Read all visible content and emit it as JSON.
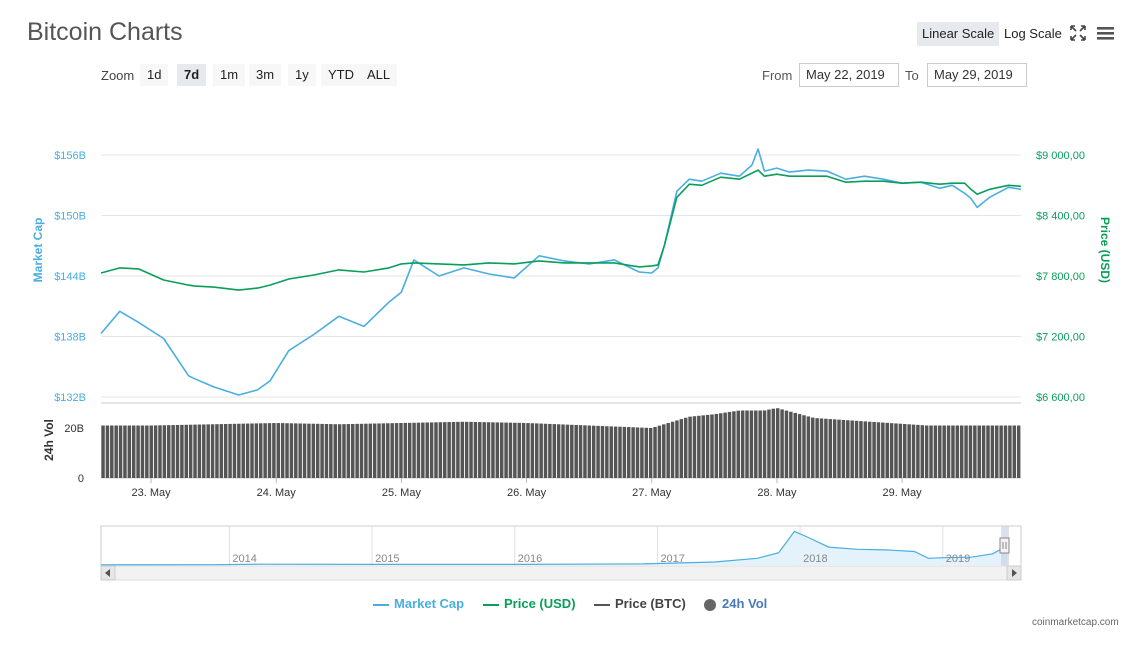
{
  "header": {
    "title": "Bitcoin Charts",
    "linear_scale_label": "Linear Scale",
    "log_scale_label": "Log Scale",
    "fullscreen_icon": "fullscreen-icon",
    "menu_icon": "hamburger-menu-icon"
  },
  "zoom": {
    "label": "Zoom",
    "buttons": [
      "1d",
      "7d",
      "1m",
      "3m",
      "1y",
      "YTD",
      "ALL"
    ],
    "active": "7d"
  },
  "range": {
    "from_label": "From",
    "from_value": "May 22, 2019",
    "to_label": "To",
    "to_value": "May 29, 2019"
  },
  "colors": {
    "market_cap": "#4aaee0",
    "price_usd": "#0a9e5a",
    "price_btc": "#555555",
    "volume": "#555555",
    "grid": "#e6e6e6"
  },
  "chart_data": {
    "type": "line",
    "left_axis": {
      "label": "Market Cap",
      "ticks": [
        "$156B",
        "$150B",
        "$144B",
        "$138B",
        "$132B"
      ],
      "tick_values": [
        156,
        150,
        144,
        138,
        132
      ],
      "range": [
        132,
        156
      ]
    },
    "right_axis": {
      "label": "Price (USD)",
      "ticks": [
        "$9 000,00",
        "$8 400,00",
        "$7 800,00",
        "$7 200,00",
        "$6 600,00"
      ],
      "tick_values": [
        9000,
        8400,
        7800,
        7200,
        6600
      ],
      "range": [
        6600,
        9000
      ]
    },
    "volume_axis": {
      "label": "24h Vol",
      "ticks": [
        "20B",
        "0"
      ],
      "tick_values": [
        20,
        0
      ],
      "range": [
        0,
        30
      ]
    },
    "x_labels": [
      "23. May",
      "24. May",
      "25. May",
      "26. May",
      "27. May",
      "28. May",
      "29. May"
    ],
    "x_label_days": [
      1,
      2,
      3,
      4,
      5,
      6,
      7
    ],
    "x_range_days": [
      0.6,
      7.95
    ],
    "series": [
      {
        "name": "Market Cap",
        "unit": "B",
        "x_days": [
          0.6,
          0.75,
          0.9,
          1.1,
          1.3,
          1.35,
          1.5,
          1.7,
          1.85,
          1.95,
          2.1,
          2.3,
          2.5,
          2.7,
          2.9,
          3.0,
          3.1,
          3.3,
          3.5,
          3.7,
          3.9,
          4.1,
          4.3,
          4.5,
          4.7,
          4.9,
          5.0,
          5.05,
          5.1,
          5.2,
          5.3,
          5.4,
          5.55,
          5.7,
          5.8,
          5.85,
          5.9,
          6.0,
          6.1,
          6.25,
          6.4,
          6.55,
          6.7,
          6.85,
          7.0,
          7.15,
          7.3,
          7.4,
          7.5,
          7.55,
          7.6,
          7.7,
          7.85,
          7.95
        ],
        "values": [
          138.3,
          140.5,
          139.4,
          137.8,
          134.1,
          133.8,
          133.0,
          132.2,
          132.7,
          133.6,
          136.6,
          138.2,
          140.0,
          139.0,
          141.4,
          142.4,
          145.6,
          144.0,
          144.8,
          144.2,
          143.8,
          146.0,
          145.5,
          145.2,
          145.6,
          144.4,
          144.3,
          144.8,
          147.0,
          152.4,
          153.6,
          153.4,
          154.2,
          153.9,
          155.0,
          156.6,
          154.4,
          154.7,
          154.3,
          154.5,
          154.4,
          153.6,
          153.9,
          153.6,
          153.2,
          153.3,
          152.7,
          153.0,
          152.2,
          151.7,
          150.8,
          151.8,
          152.8,
          152.6
        ]
      },
      {
        "name": "Price (USD)",
        "unit": "USD",
        "x_days": [
          0.6,
          0.75,
          0.9,
          1.1,
          1.3,
          1.35,
          1.5,
          1.7,
          1.85,
          1.95,
          2.1,
          2.3,
          2.5,
          2.7,
          2.9,
          3.0,
          3.1,
          3.3,
          3.5,
          3.7,
          3.9,
          4.1,
          4.3,
          4.5,
          4.7,
          4.9,
          5.0,
          5.05,
          5.1,
          5.2,
          5.3,
          5.4,
          5.55,
          5.7,
          5.8,
          5.85,
          5.9,
          6.0,
          6.1,
          6.25,
          6.4,
          6.55,
          6.7,
          6.85,
          7.0,
          7.15,
          7.3,
          7.4,
          7.5,
          7.55,
          7.6,
          7.7,
          7.85,
          7.95
        ],
        "values": [
          7830,
          7880,
          7870,
          7760,
          7710,
          7700,
          7690,
          7660,
          7680,
          7710,
          7770,
          7810,
          7860,
          7840,
          7880,
          7920,
          7930,
          7920,
          7910,
          7930,
          7920,
          7950,
          7930,
          7930,
          7930,
          7890,
          7900,
          7910,
          8100,
          8580,
          8710,
          8700,
          8780,
          8760,
          8820,
          8850,
          8790,
          8810,
          8790,
          8790,
          8790,
          8730,
          8740,
          8740,
          8720,
          8730,
          8710,
          8720,
          8720,
          8660,
          8610,
          8660,
          8700,
          8690
        ]
      },
      {
        "name": "Price (BTC)",
        "x_days": [],
        "values": []
      },
      {
        "name": "24h Vol",
        "unit": "B",
        "x_days": [
          0.6,
          1.0,
          1.5,
          2.0,
          2.5,
          3.0,
          3.5,
          4.0,
          4.5,
          5.0,
          5.1,
          5.3,
          5.5,
          5.7,
          5.9,
          6.0,
          6.3,
          6.6,
          6.9,
          7.2,
          7.5,
          7.95
        ],
        "values": [
          21,
          21,
          21.5,
          22,
          21.5,
          22,
          22.5,
          22,
          21,
          20,
          21.5,
          24.5,
          25.5,
          27,
          27,
          28,
          24,
          23,
          22,
          21,
          21,
          21
        ]
      }
    ],
    "navigator": {
      "labels": [
        "2014",
        "2015",
        "2016",
        "2017",
        "2018",
        "2019"
      ],
      "years": [
        2014,
        2015,
        2016,
        2017,
        2018,
        2019
      ],
      "range_years": [
        2013.1,
        2019.45
      ],
      "points_years": [
        2013.1,
        2013.9,
        2014.2,
        2015.0,
        2016.0,
        2016.9,
        2017.4,
        2017.7,
        2017.85,
        2017.96,
        2018.05,
        2018.2,
        2018.4,
        2018.6,
        2018.8,
        2018.9,
        2019.0,
        2019.2,
        2019.35,
        2019.45
      ],
      "points_values": [
        2,
        3,
        7,
        5,
        5,
        10,
        27,
        60,
        110,
        300,
        250,
        160,
        140,
        135,
        120,
        60,
        65,
        70,
        100,
        170
      ],
      "value_range": [
        0,
        330
      ]
    },
    "grid": true,
    "legend_placement": "bottom-center"
  },
  "legend": {
    "market_cap": "Market Cap",
    "price_usd": "Price (USD)",
    "price_btc": "Price (BTC)",
    "volume": "24h Vol"
  },
  "footer": {
    "credit": "coinmarketcap.com"
  }
}
